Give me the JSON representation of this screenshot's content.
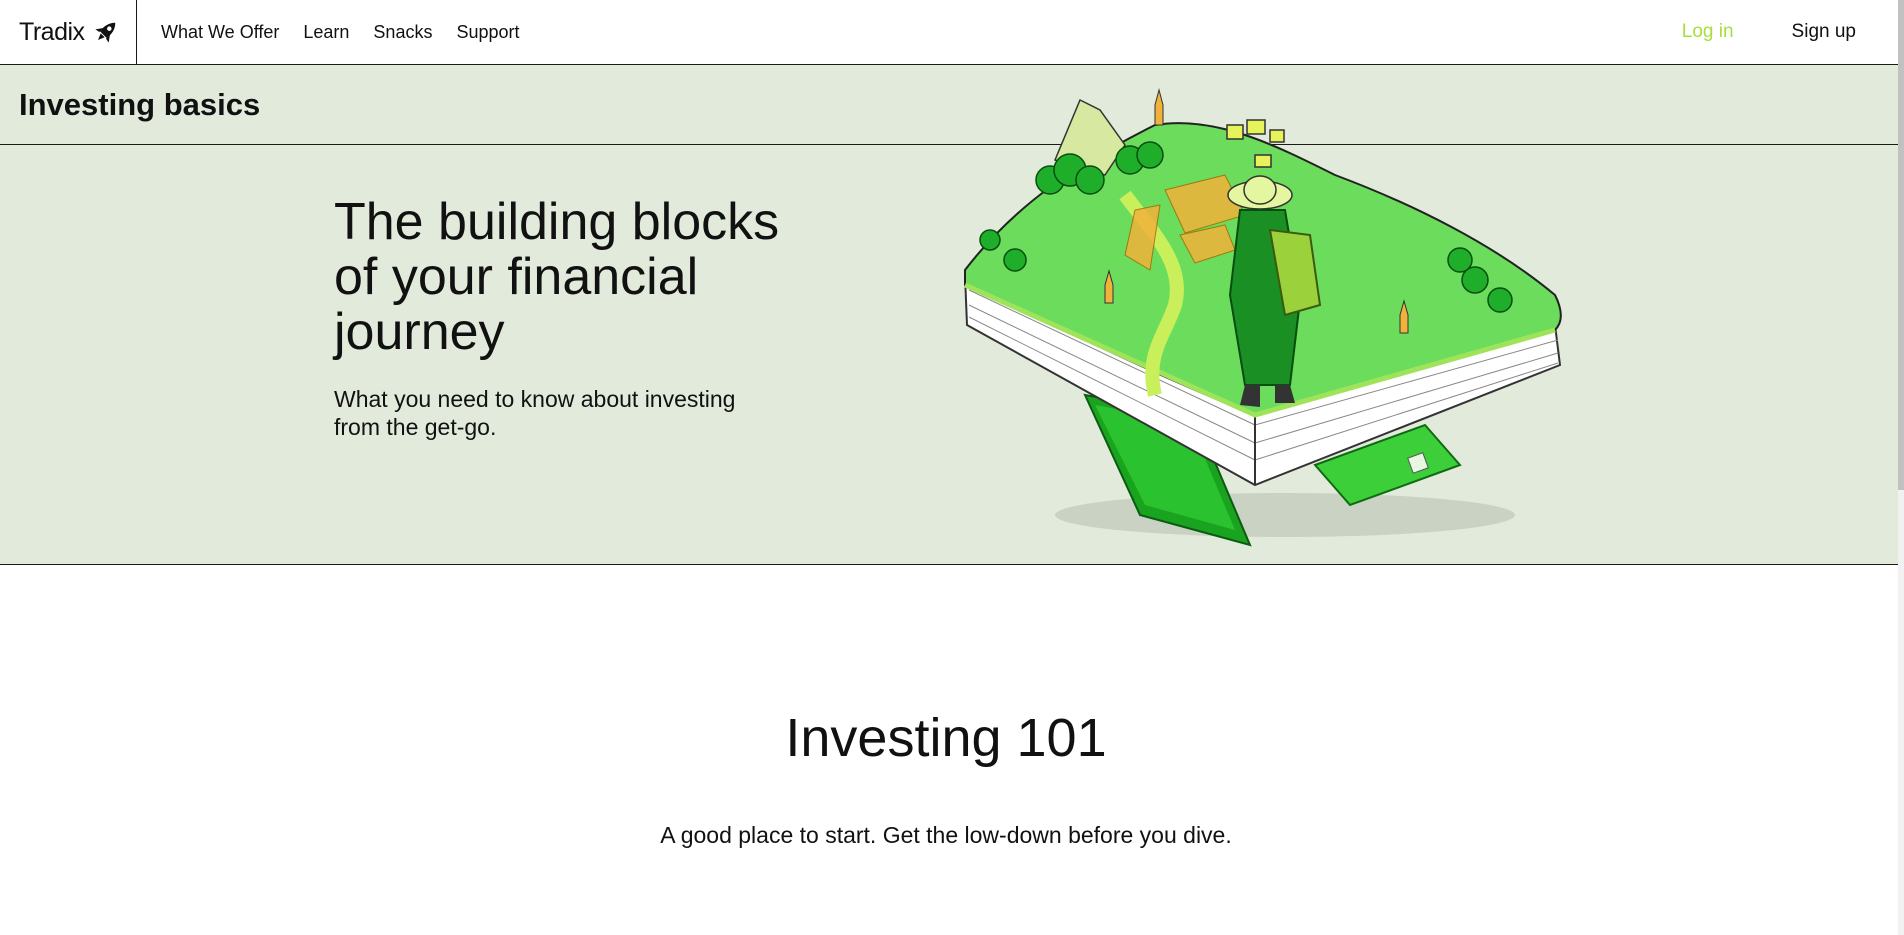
{
  "brand": {
    "name": "Tradix",
    "icon": "rocket-icon"
  },
  "nav": {
    "links": [
      "What We Offer",
      "Learn",
      "Snacks",
      "Support"
    ],
    "login_label": "Log in",
    "signup_label": "Sign up"
  },
  "hero": {
    "section_title": "Investing basics",
    "heading": "The building blocks of your financial journey",
    "subheading": "What you need to know about investing from the get-go.",
    "illustration": "explorer-on-book-island-illustration"
  },
  "intro": {
    "title": "Investing 101",
    "subtitle": "A good place to start. Get the low-down before you dive."
  },
  "colors": {
    "hero_background": "#e1eadb",
    "login_accent": "#a6df3a",
    "illustration_green": "#6bdc5c"
  }
}
